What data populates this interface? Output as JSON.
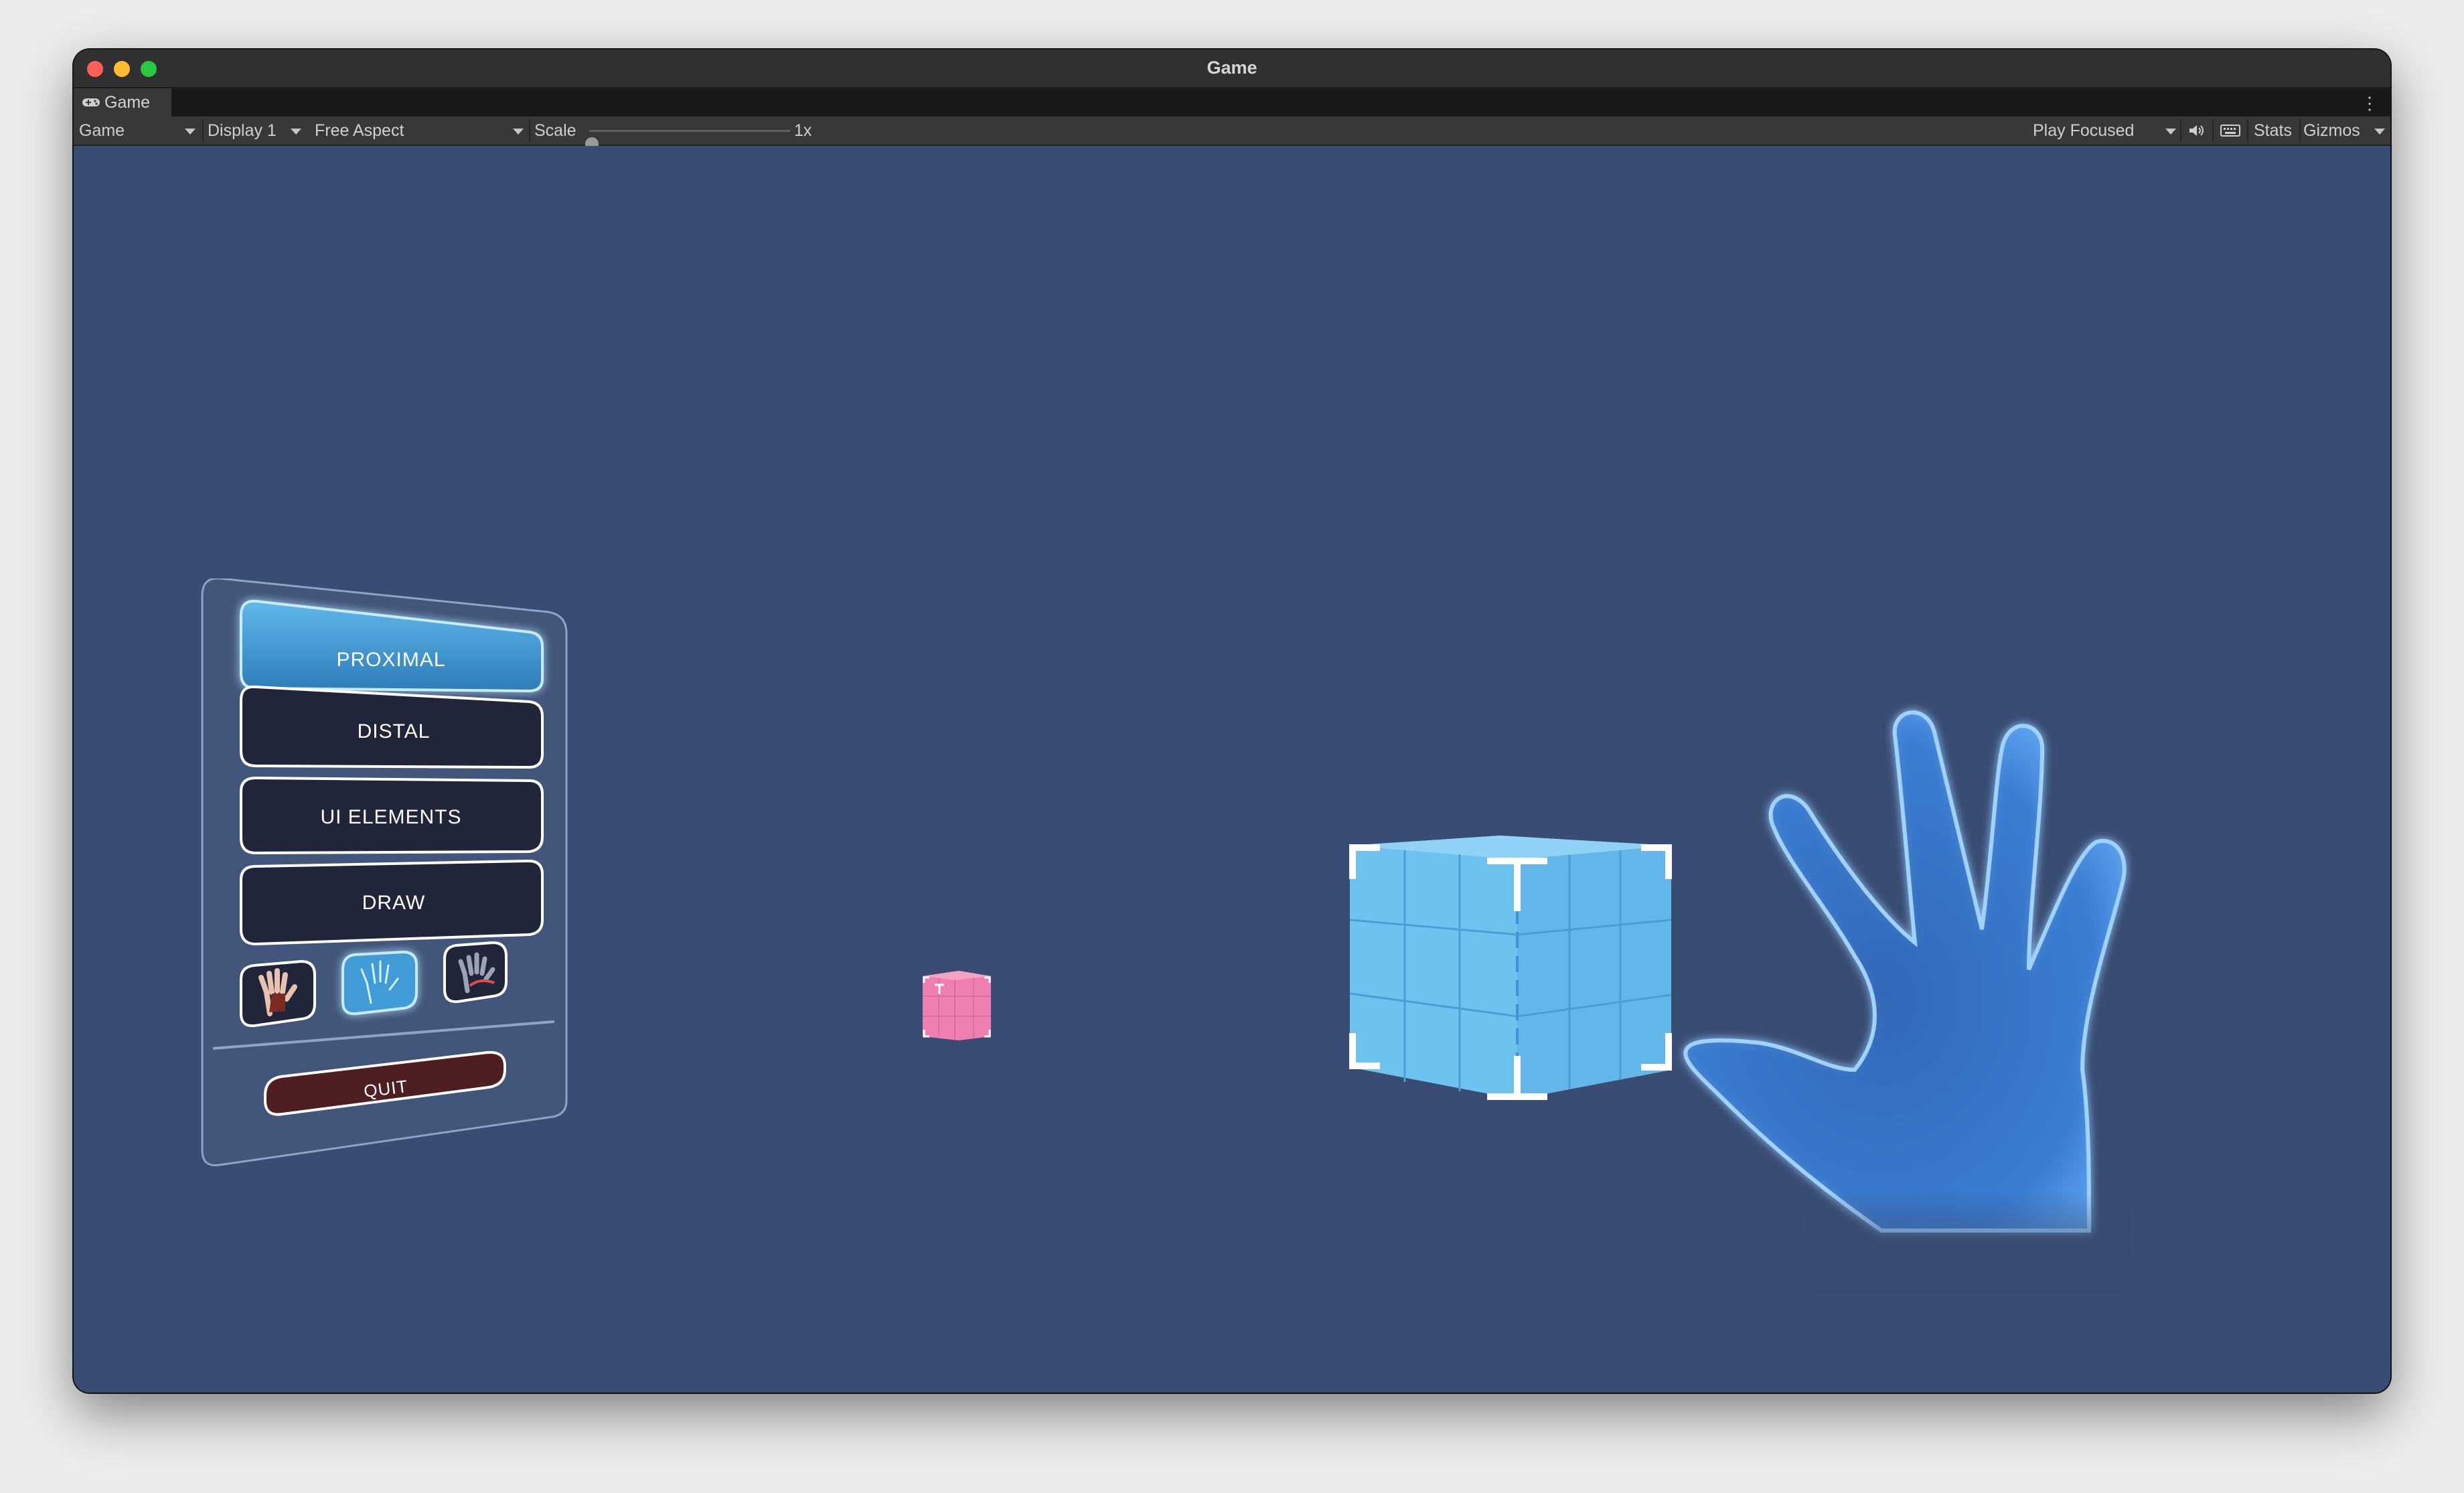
{
  "window": {
    "title": "Game"
  },
  "tab": {
    "label": "Game",
    "icon": "gamepad-icon"
  },
  "toolbar": {
    "view_select": "Game",
    "display_select": "Display 1",
    "aspect_select": "Free Aspect",
    "scale_label": "Scale",
    "scale_value": "1x",
    "play_mode_select": "Play Focused",
    "stats_label": "Stats",
    "gizmos_label": "Gizmos",
    "mute_icon": "speaker-icon",
    "shortcuts_icon": "keyboard-icon"
  },
  "menu_panel": {
    "buttons": [
      "PROXIMAL",
      "DISTAL",
      "UI ELEMENTS",
      "DRAW"
    ],
    "selected_button": "PROXIMAL",
    "hand_toggles": [
      "hand-skeleton-icon",
      "hand-outline-icon",
      "hand-hidden-icon"
    ],
    "selected_hand_toggle": "hand-outline-icon",
    "quit_label": "QUIT"
  },
  "colors": {
    "scene_bg": "#394c74",
    "button_bg": "#20253a",
    "button_selected": "#3f9bd6",
    "quit_bg": "#4e1e22",
    "small_cube": "#ef7fb0",
    "large_cube": "#6ec2f0",
    "hand": "#3d7fd0"
  }
}
